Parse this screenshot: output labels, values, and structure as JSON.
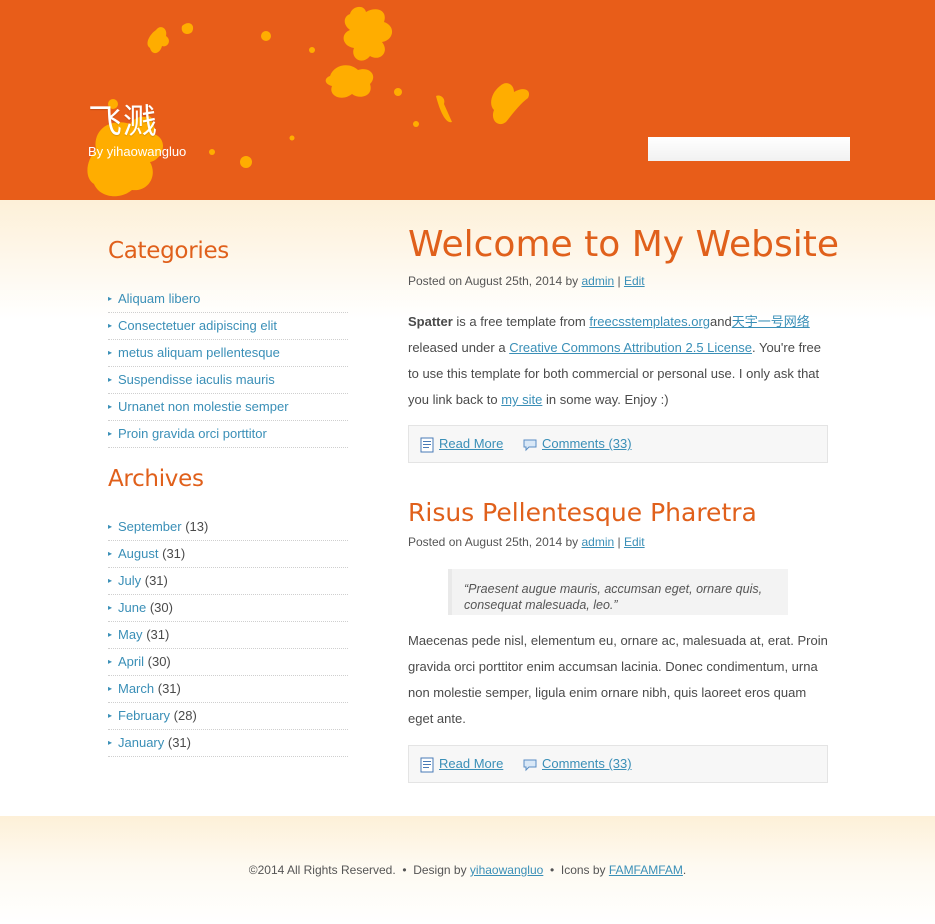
{
  "header": {
    "title": "飞溅",
    "tagline": "By yihaowangluo",
    "search_placeholder": "",
    "colors": {
      "background": "#e85d19",
      "splatter": "#ffad00"
    }
  },
  "sidebar": {
    "categories": {
      "title": "Categories",
      "items": [
        {
          "label": "Aliquam libero"
        },
        {
          "label": "Consectetuer adipiscing elit"
        },
        {
          "label": "metus aliquam pellentesque"
        },
        {
          "label": "Suspendisse iaculis mauris"
        },
        {
          "label": "Urnanet non molestie semper"
        },
        {
          "label": "Proin gravida orci porttitor"
        }
      ]
    },
    "archives": {
      "title": "Archives",
      "items": [
        {
          "label": "September",
          "count": "(13)"
        },
        {
          "label": "August",
          "count": "(31)"
        },
        {
          "label": "July",
          "count": "(31)"
        },
        {
          "label": "June",
          "count": "(30)"
        },
        {
          "label": "May",
          "count": "(31)"
        },
        {
          "label": "April",
          "count": "(30)"
        },
        {
          "label": "March",
          "count": "(31)"
        },
        {
          "label": "February",
          "count": "(28)"
        },
        {
          "label": "January",
          "count": "(31)"
        }
      ]
    }
  },
  "posts": [
    {
      "title": "Welcome to My Website",
      "meta_prefix": "Posted on August 25th, 2014 by ",
      "author": "admin",
      "separator": " | ",
      "edit": "Edit",
      "body": {
        "strong": "Spatter",
        "t1": " is a free template from ",
        "link1": "freecsstemplates.org",
        "t2": "and",
        "link2": "天宇一号网络",
        "t3": " released under a ",
        "link3": "Creative Commons Attribution 2.5 License",
        "t4": ". You're free to use this template for both commercial or personal use. I only ask that you link back to ",
        "link4": "my site",
        "t5": " in some way. Enjoy :)"
      },
      "read_more": "Read More",
      "comments": "Comments (33)"
    },
    {
      "title": "Risus Pellentesque Pharetra",
      "meta_prefix": "Posted on August 25th, 2014 by ",
      "author": "admin",
      "separator": " | ",
      "edit": "Edit",
      "quote": "“Praesent augue mauris, accumsan eget, ornare quis, consequat malesuada, leo.”",
      "body_text": "Maecenas pede nisl, elementum eu, ornare ac, malesuada at, erat. Proin gravida orci porttitor enim accumsan lacinia. Donec condimentum, urna non molestie semper, ligula enim ornare nibh, quis laoreet eros quam eget ante.",
      "read_more": "Read More",
      "comments": "Comments (33)"
    }
  ],
  "footer": {
    "copyright": "©2014 All Rights Reserved.",
    "dot": "  •  ",
    "design_label": "Design by ",
    "designer": "yihaowangluo",
    "icons_label": "Icons by ",
    "icons_author": "FAMFAMFAM",
    "end": "."
  },
  "icons": {
    "read_more": "document-icon",
    "comments": "speech-bubble-icon"
  }
}
